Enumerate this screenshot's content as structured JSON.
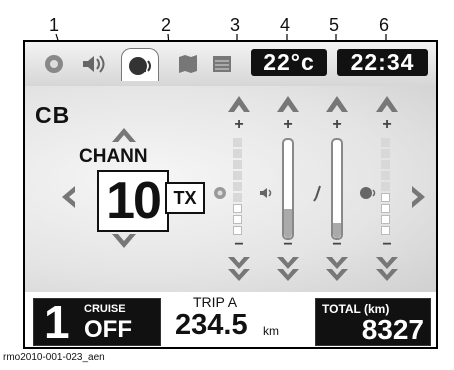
{
  "callouts": [
    "1",
    "2",
    "3",
    "4",
    "5",
    "6"
  ],
  "topbar": {
    "tabs": [
      {
        "icon": "radio-icon"
      },
      {
        "icon": "speaker-icon"
      },
      {
        "icon": "intercom-icon",
        "active": true
      },
      {
        "icon": "map-icon"
      },
      {
        "icon": "list-icon"
      }
    ],
    "temperature": "22°c",
    "time": "22:34"
  },
  "cb": {
    "label": "CB",
    "channel_label": "CHANN",
    "channel": "10",
    "tx": "TX"
  },
  "levels": [
    {
      "icon": "radio-icon",
      "type": "segments",
      "lit_fraction": 0.3
    },
    {
      "icon": "speaker-icon",
      "type": "tube",
      "fill_fraction": 0.3
    },
    {
      "icon": "microphone-icon",
      "type": "tube",
      "fill_fraction": 0.15
    },
    {
      "icon": "intercom-icon",
      "type": "segments",
      "lit_fraction": 0.45
    }
  ],
  "bottom": {
    "gear": "1",
    "cruise_label": "CRUISE",
    "cruise_value": "OFF",
    "trip_label": "TRIP A",
    "trip_value": "234.5",
    "trip_unit": "km",
    "total_label": "TOTAL (km)",
    "total_value": "8327"
  },
  "caption": "rmo2010-001-023_aen"
}
